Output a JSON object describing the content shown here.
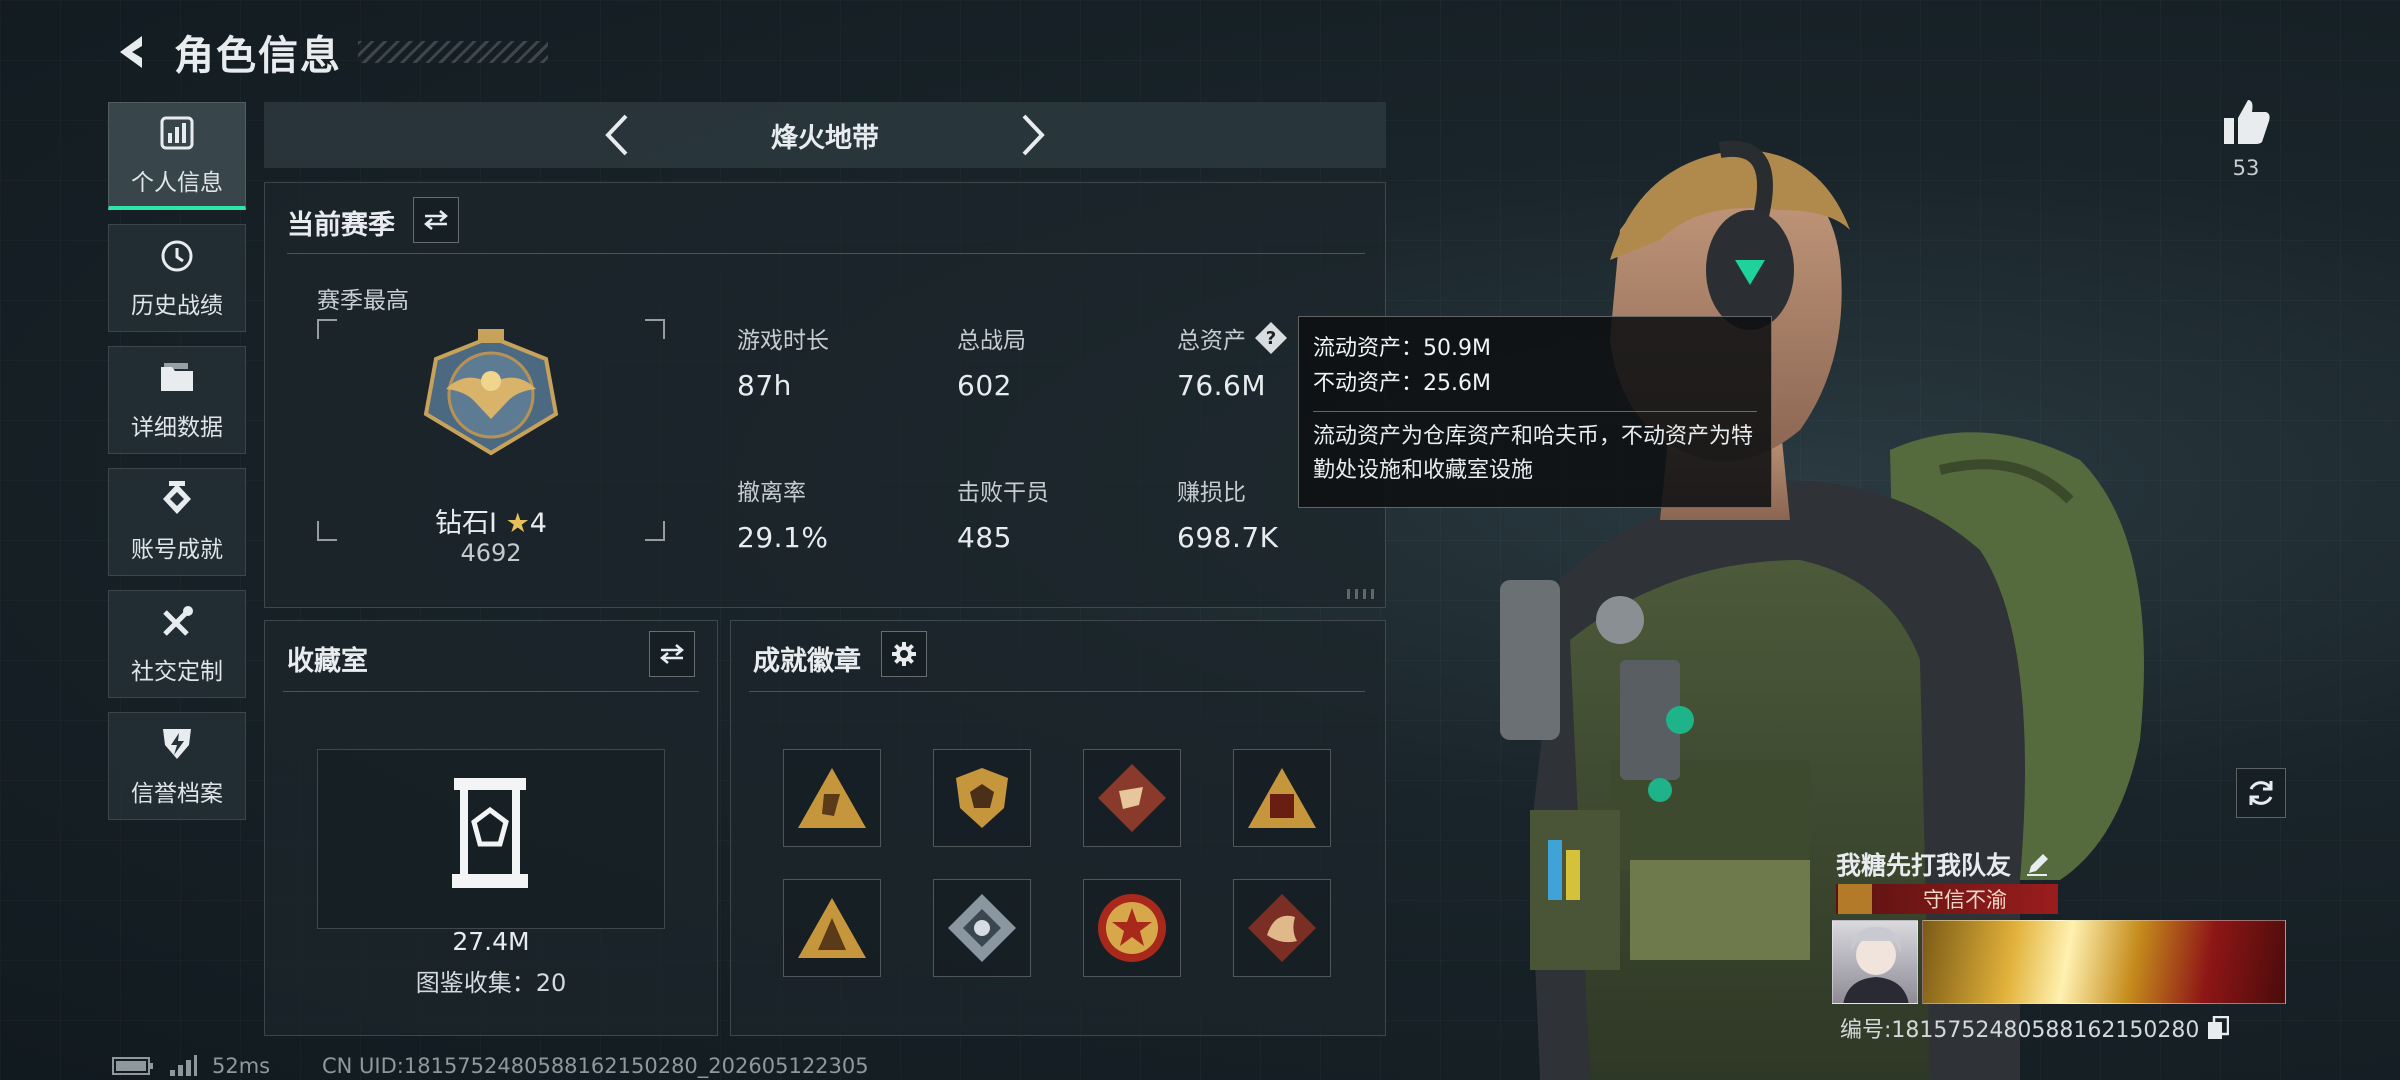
{
  "header": {
    "title": "角色信息"
  },
  "nav": [
    {
      "label": "个人信息",
      "icon": "bar-chart-icon",
      "active": true
    },
    {
      "label": "历史战绩",
      "icon": "history-clock-icon",
      "active": false
    },
    {
      "label": "详细数据",
      "icon": "folder-icon",
      "active": false
    },
    {
      "label": "账号成就",
      "icon": "achievement-diamond-icon",
      "active": false
    },
    {
      "label": "社交定制",
      "icon": "tools-icon",
      "active": false
    },
    {
      "label": "信誉档案",
      "icon": "shield-emblem-icon",
      "active": false
    }
  ],
  "mode_bar": {
    "title": "烽火地带"
  },
  "season": {
    "title": "当前赛季",
    "best_label": "赛季最高",
    "rank_name": "钻石Ⅰ",
    "rank_stars": "4",
    "rank_score": "4692",
    "stats": [
      {
        "label": "游戏时长",
        "value": "87h"
      },
      {
        "label": "总战局",
        "value": "602"
      },
      {
        "label": "总资产",
        "value": "76.6M"
      },
      {
        "label": "撤离率",
        "value": "29.1%"
      },
      {
        "label": "击败干员",
        "value": "485"
      },
      {
        "label": "赚损比",
        "value": "698.7K"
      }
    ]
  },
  "tooltip": {
    "liquid": "流动资产：50.9M",
    "fixed": "不动资产：25.6M",
    "desc": "流动资产为仓库资产和哈夫币，不动资产为特勤处设施和收藏室设施"
  },
  "collection": {
    "title": "收藏室",
    "value": "27.4M",
    "count": "图鉴收集：20"
  },
  "badges": {
    "title": "成就徽章",
    "items": [
      "badge-1",
      "badge-2",
      "badge-3",
      "badge-4",
      "badge-5",
      "badge-6",
      "badge-7",
      "badge-8"
    ]
  },
  "likes": {
    "count": "53"
  },
  "player": {
    "name": "我糖先打我队友",
    "honor": "守信不渝",
    "uid": "编号:1815752480588162150280"
  },
  "footer": {
    "ping": "52ms",
    "cn_uid": "CN UID:1815752480588162150280_202605122305"
  },
  "colors": {
    "accent": "#2ee6a5",
    "honor_red": "#9a1d1d",
    "gold": "#d4a23a"
  }
}
